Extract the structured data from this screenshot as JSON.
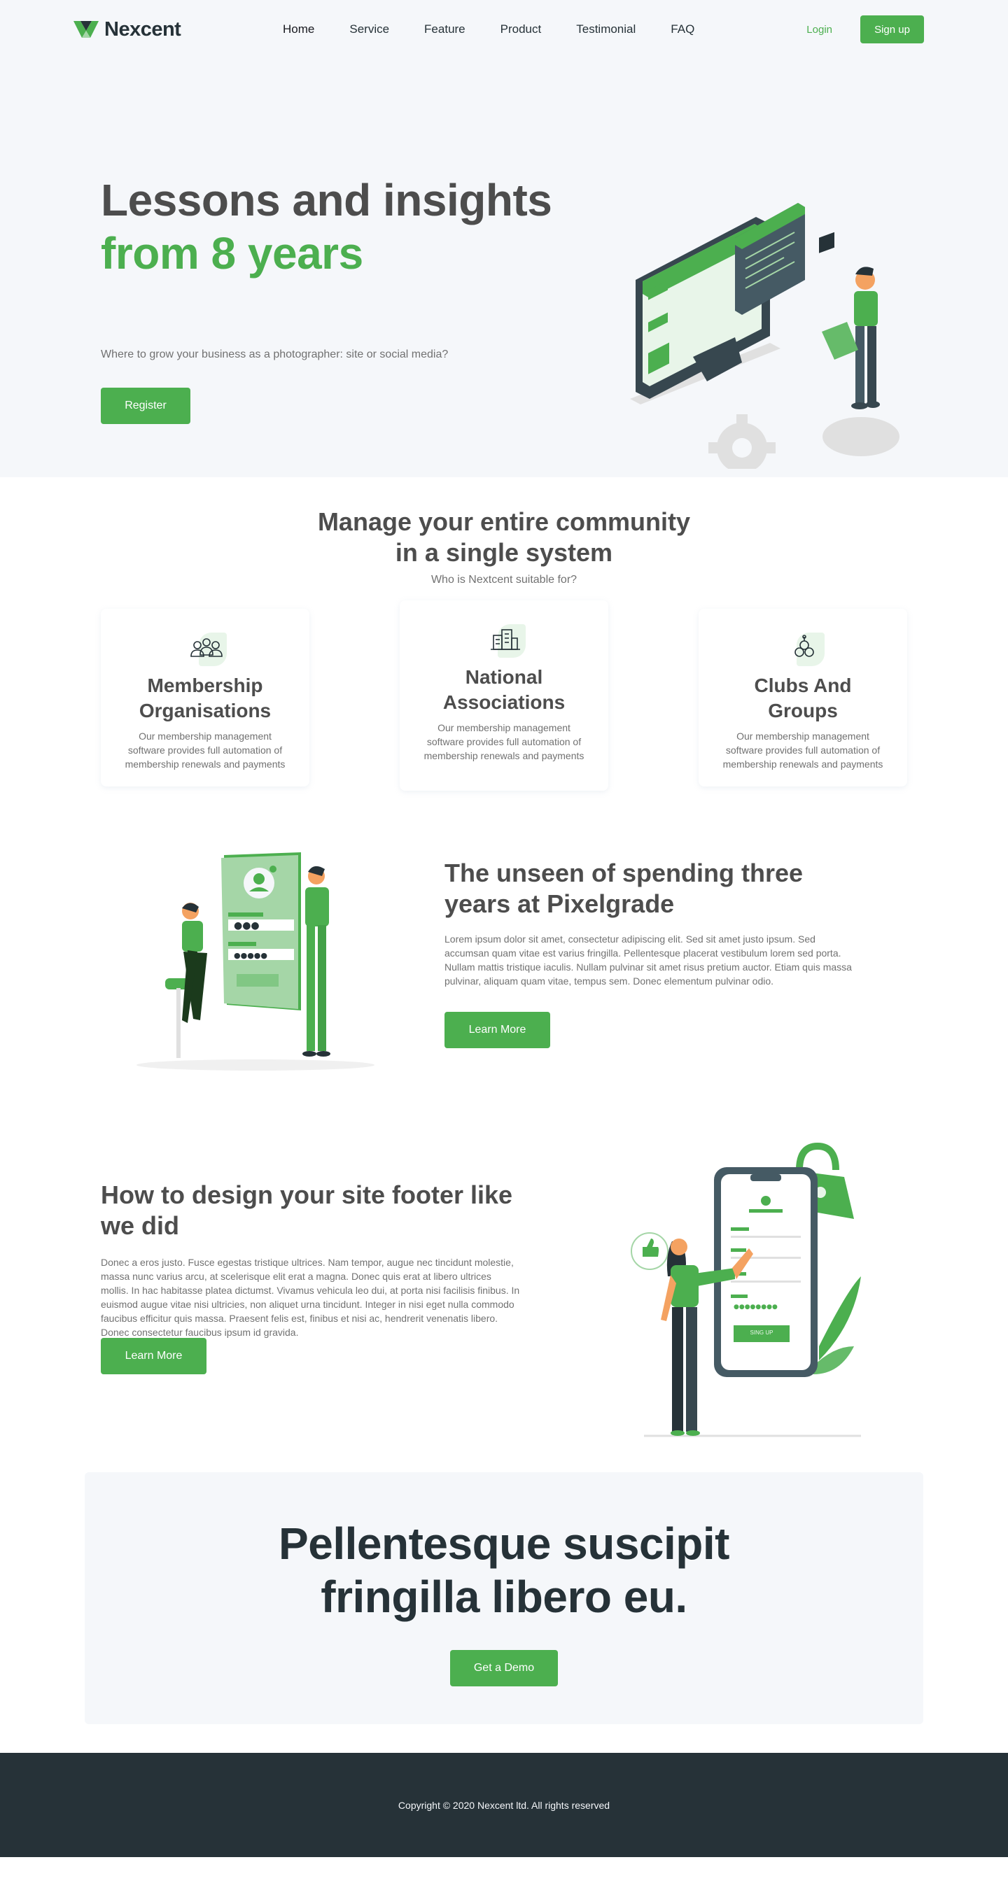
{
  "nav": {
    "brand": "Nexcent",
    "menu": [
      "Home",
      "Service",
      "Feature",
      "Product",
      "Testimonial",
      "FAQ"
    ],
    "login": "Login",
    "signup": "Sign up"
  },
  "hero": {
    "title_line1": "Lessons and insights",
    "title_line2": "from 8 years",
    "subtitle": "Where to grow your business as a photographer: site or social media?",
    "cta": "Register"
  },
  "community": {
    "title_line1": "Manage your entire community",
    "title_line2": "in a single system",
    "subtitle": "Who is Nextcent suitable for?",
    "cards": [
      {
        "title_line1": "Membership",
        "title_line2": "Organisations",
        "text": "Our membership management software provides full automation of membership renewals and payments",
        "icon": "people-icon"
      },
      {
        "title_line1": "National",
        "title_line2": "Associations",
        "text": "Our membership management software provides full automation of membership renewals and payments",
        "icon": "building-icon"
      },
      {
        "title_line1": "Clubs And",
        "title_line2": "Groups",
        "text": "Our membership management software provides full automation of membership renewals and payments",
        "icon": "club-icon"
      }
    ]
  },
  "feature1": {
    "title": "The unseen of spending three years at Pixelgrade",
    "text": "Lorem ipsum dolor sit amet, consectetur adipiscing elit. Sed sit amet justo ipsum. Sed accumsan quam vitae est varius fringilla. Pellentesque placerat vestibulum lorem sed porta. Nullam mattis tristique iaculis. Nullam pulvinar sit amet risus pretium auctor. Etiam quis massa pulvinar, aliquam quam vitae, tempus sem. Donec elementum pulvinar odio.",
    "cta": "Learn More"
  },
  "feature2": {
    "title": "How to design your site footer like we did",
    "text": "Donec a eros justo. Fusce egestas tristique ultrices. Nam tempor, augue nec tincidunt molestie, massa nunc varius arcu, at scelerisque elit erat a magna. Donec quis erat at libero ultrices mollis. In hac habitasse platea dictumst. Vivamus vehicula leo dui, at porta nisi facilisis finibus. In euismod augue vitae nisi ultricies, non aliquet urna tincidunt. Integer in nisi eget nulla commodo faucibus efficitur quis massa. Praesent felis est, finibus et nisi ac, hendrerit venenatis libero. Donec consectetur faucibus ipsum id gravida.",
    "cta": "Learn More",
    "phone_button": "SING UP"
  },
  "cta": {
    "title_line1": "Pellentesque suscipit",
    "title_line2": "fringilla libero eu.",
    "button": "Get a Demo"
  },
  "footer": {
    "copyright": "Copyright © 2020 Nexcent ltd.  All rights reserved"
  },
  "colors": {
    "primary": "#4CAF4F",
    "dark": "#263238",
    "text": "#4D4D4D",
    "muted": "#717171",
    "silver": "#F5F7FA"
  }
}
